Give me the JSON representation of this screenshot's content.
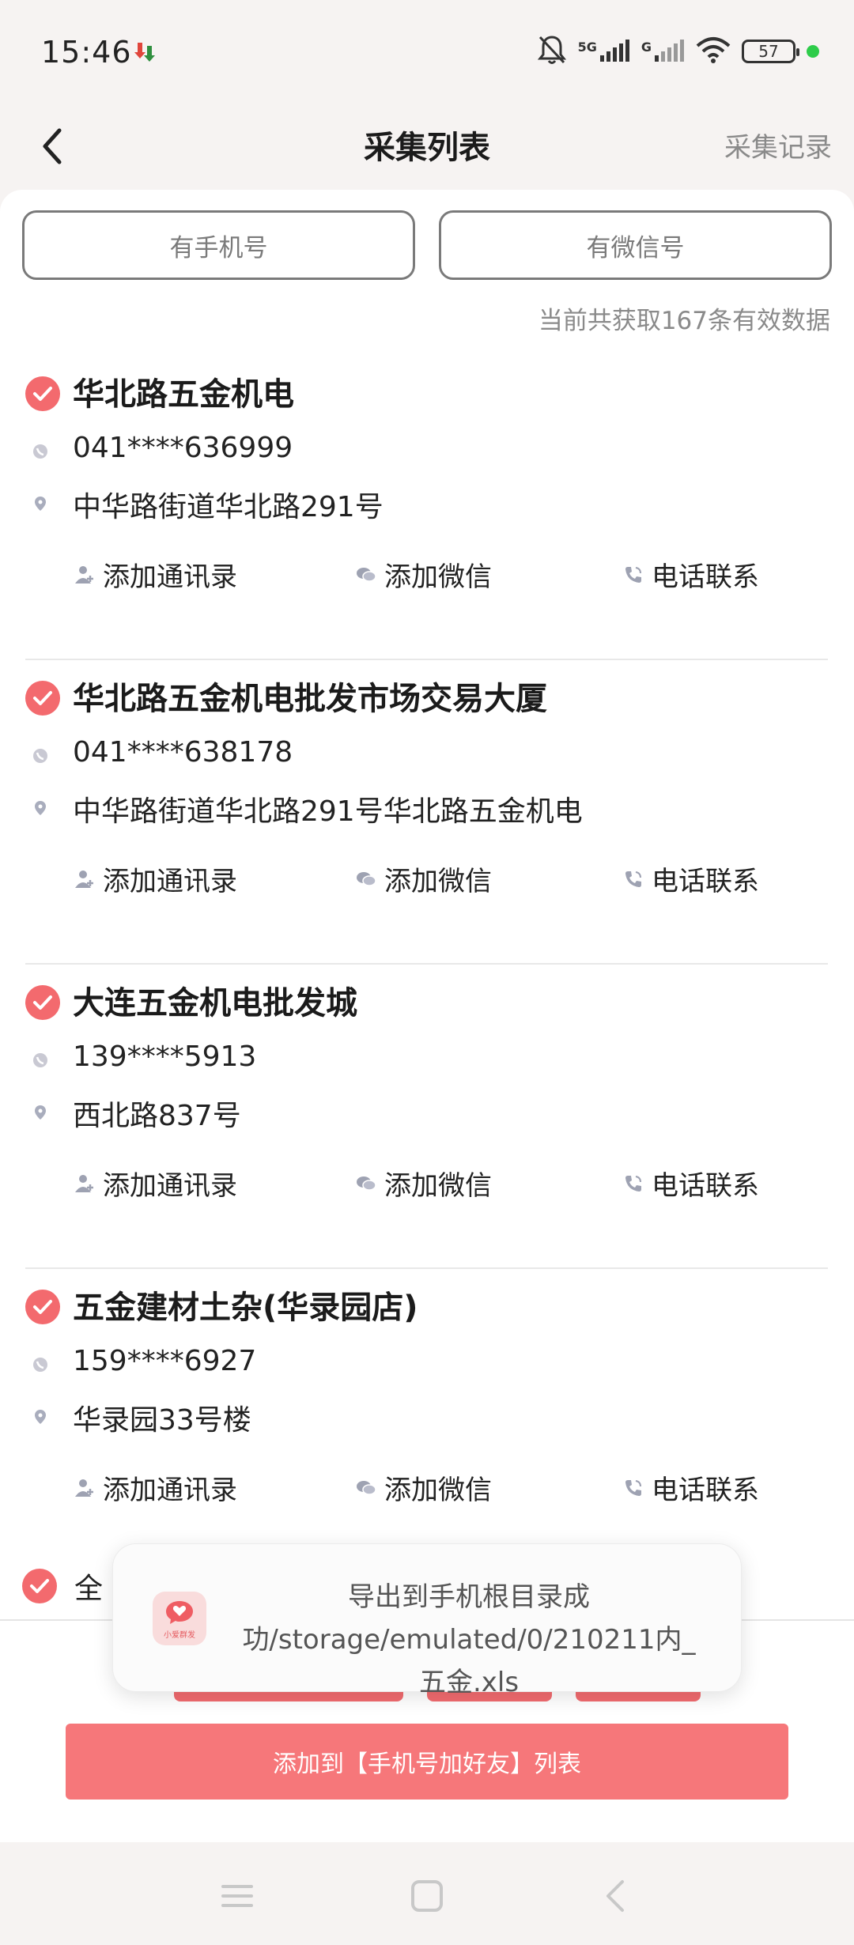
{
  "status_bar": {
    "time": "15:46",
    "network_1": "5G",
    "network_2": "G",
    "battery": "57",
    "icons": [
      "app-download-icon",
      "mute-bell-icon",
      "signal-icon",
      "wifi-icon",
      "battery-icon"
    ]
  },
  "header": {
    "title": "采集列表",
    "right_link": "采集记录"
  },
  "filters": {
    "phone": "有手机号",
    "wechat": "有微信号"
  },
  "summary": "当前共获取167条有效数据",
  "items": [
    {
      "title": "华北路五金机电",
      "phone": "041****636999",
      "address": "中华路街道华北路291号"
    },
    {
      "title": "华北路五金机电批发市场交易大厦",
      "phone": "041****638178",
      "address": "中华路街道华北路291号华北路五金机电"
    },
    {
      "title": "大连五金机电批发城",
      "phone": "139****5913",
      "address": "西北路837号"
    },
    {
      "title": "五金建材土杂(华录园店)",
      "phone": "159****6927",
      "address": "华录园33号楼"
    }
  ],
  "actions": {
    "add_contacts": "添加通讯录",
    "add_wechat": "添加微信",
    "call": "电话联系"
  },
  "select_all_label": "全",
  "toast": {
    "message": "导出到手机根目录成功/storage/emulated/0/210211内_五金.xls",
    "app_label": "小爱群发"
  },
  "bottom_button": "添加到【手机号加好友】列表",
  "colors": {
    "accent": "#f36a6e",
    "button": "#f6777a",
    "muted": "#8a8a8a"
  }
}
